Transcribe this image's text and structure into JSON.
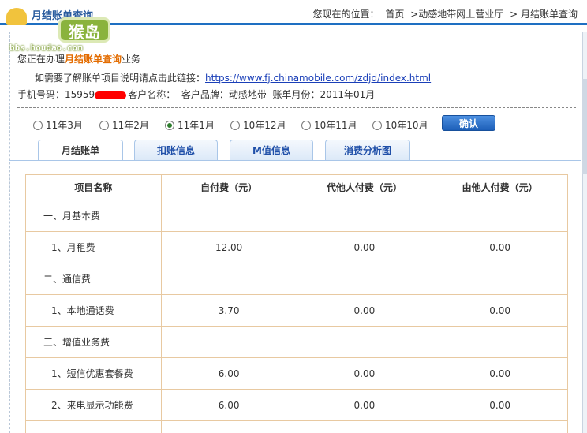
{
  "header": {
    "logo_title": "月结账单查询",
    "logo_badge": "猴岛",
    "logo_url": "bbs.houdao.com",
    "breadcrumb": {
      "prefix": "您现在的位置：",
      "items": [
        "首页",
        ">动感地带网上营业厅",
        "> 月结账单查询"
      ]
    }
  },
  "intro": {
    "before": "您正在办理",
    "highlight": "月结账单查询",
    "after": "业务"
  },
  "help": {
    "text": "如需要了解账单项目说明请点击此链接：",
    "link": "https://www.fj.chinamobile.com/zdjd/index.html"
  },
  "info": {
    "phone_label": "手机号码：15959",
    "customer_label": "客户名称：",
    "brand_label": "客户品牌：动感地带",
    "month_label": "账单月份：2011年01月"
  },
  "months": {
    "options": [
      "11年3月",
      "11年2月",
      "11年1月",
      "10年12月",
      "10年11月",
      "10年10月"
    ],
    "selected": "11年1月"
  },
  "confirm_label": "确认",
  "tabs": [
    "月结账单",
    "扣账信息",
    "M值信息",
    "消费分析图"
  ],
  "active_tab": "月结账单",
  "table": {
    "headers": [
      "项目名称",
      "自付费（元）",
      "代他人付费（元）",
      "由他人付费（元）"
    ],
    "rows": [
      [
        "一、月基本费",
        "",
        "",
        ""
      ],
      [
        "1、月租费",
        "12.00",
        "0.00",
        "0.00"
      ],
      [
        "二、通信费",
        "",
        "",
        ""
      ],
      [
        "1、本地通话费",
        "3.70",
        "0.00",
        "0.00"
      ],
      [
        "三、增值业务费",
        "",
        "",
        ""
      ],
      [
        "1、短信优惠套餐费",
        "6.00",
        "0.00",
        "0.00"
      ],
      [
        "2、来电显示功能费",
        "6.00",
        "0.00",
        "0.00"
      ],
      [
        "",
        "",
        "",
        ""
      ]
    ]
  },
  "colors": {
    "accent": "#1e6fc2",
    "highlight": "#e36c00",
    "link": "#1a3fb8",
    "table_border": "#e8c9a1",
    "redaction": "#ff0000"
  }
}
